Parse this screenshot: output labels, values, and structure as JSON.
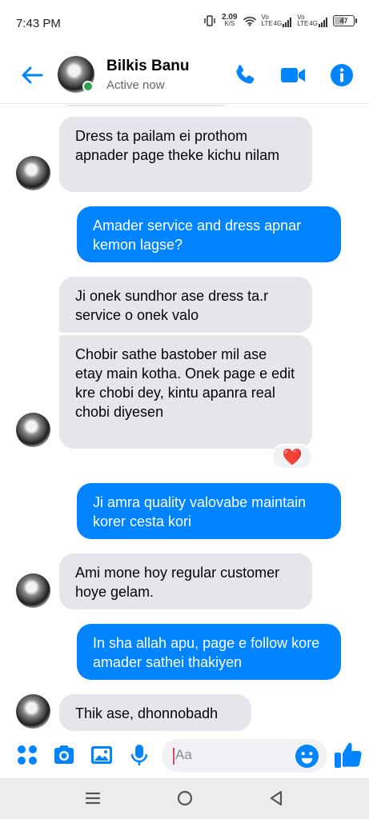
{
  "status_bar": {
    "time": "7:43 PM",
    "speed_value": "2.09",
    "speed_unit": "K/S",
    "sim1_label": "Vo",
    "sim1_sub": "LTE",
    "sim1_net": "4G",
    "sim2_label": "Vo",
    "sim2_sub": "LTE",
    "sim2_net": "4G",
    "battery": "47"
  },
  "header": {
    "contact_name": "Bilkis Banu",
    "status": "Active now",
    "icons": [
      "back-arrow-icon",
      "phone-icon",
      "video-icon",
      "info-icon"
    ],
    "accent_color": "#0084ff",
    "online_color": "#31a24c"
  },
  "messages": [
    {
      "side": "in",
      "text": "Dress ta pailam ei prothom apnader page theke kichu nilam"
    },
    {
      "side": "out",
      "text": "Amader service and dress apnar kemon lagse?"
    },
    {
      "side": "in",
      "text": "Ji onek sundhor ase dress ta.r service o onek valo"
    },
    {
      "side": "in",
      "text": "Chobir sathe bastober mil ase etay main kotha. Onek page e edit kre chobi dey, kintu apanra real chobi diyesen"
    },
    {
      "side": "out",
      "text": "Ji amra quality valovabe maintain korer cesta kori"
    },
    {
      "side": "in",
      "text": "Ami mone hoy regular customer hoye gelam."
    },
    {
      "side": "out",
      "text": "In sha allah apu, page e follow kore amader sathei thakiyen"
    },
    {
      "side": "in",
      "text": "Thik ase, dhonnobadh"
    }
  ],
  "reaction": {
    "emoji": "❤️"
  },
  "composer": {
    "placeholder": "Aa",
    "icons": [
      "menu-grid-icon",
      "camera-icon",
      "gallery-icon",
      "microphone-icon",
      "emoji-icon",
      "like-thumb-icon"
    ]
  },
  "colors": {
    "incoming_bubble": "#e4e6eb",
    "outgoing_bubble": "#0084ff"
  }
}
